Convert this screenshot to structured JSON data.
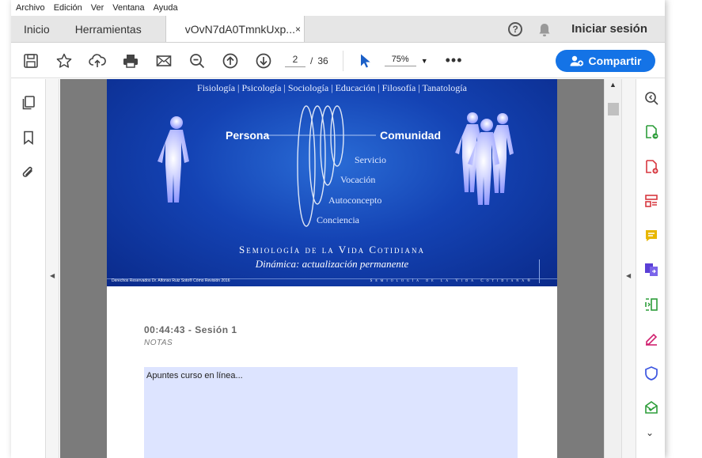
{
  "menubar": {
    "items": [
      "Archivo",
      "Edición",
      "Ver",
      "Ventana",
      "Ayuda"
    ]
  },
  "tabs": {
    "home": "Inicio",
    "tools": "Herramientas",
    "document": "vOvN7dA0TmnkUxp...",
    "close_glyph": "×"
  },
  "header": {
    "help_glyph": "?",
    "signin": "Iniciar sesión"
  },
  "toolbar": {
    "page_current": "2",
    "page_separator": "/",
    "page_total": "36",
    "zoom": "75%",
    "more_glyph": "•••",
    "share_label": "Compartir"
  },
  "icons": {
    "toolbar": [
      "save-icon",
      "bookmark-star-icon",
      "upload-cloud-icon",
      "print-icon",
      "email-icon",
      "zoom-out-icon",
      "page-up-icon",
      "page-down-icon",
      "select-cursor-icon"
    ],
    "left_rail": [
      "pages-panel-icon",
      "bookmarks-icon",
      "attachments-icon"
    ],
    "right_rail": [
      "zoom-tool-icon",
      "export-pdf-icon",
      "create-pdf-icon",
      "organize-pages-icon",
      "comment-icon",
      "combine-files-icon",
      "compress-pdf-icon",
      "fill-sign-icon",
      "protect-icon",
      "send-for-signature-icon"
    ]
  },
  "colors": {
    "accent": "#1473e6",
    "banner": "#1443b4",
    "note_box": "#dde4ff"
  },
  "banner": {
    "topics": "Fisiología | Psicología | Sociología | Educación | Filosofía | Tanatología",
    "persona": "Persona",
    "comunidad": "Comunidad",
    "servicio": "Servicio",
    "vocacion": "Vocación",
    "autoconcepto": "Autoconcepto",
    "conciencia": "Conciencia",
    "title": "Semiología de la Vida Cotidiana",
    "subtitle": "Dinámica: actualización permanente",
    "rights": "Derechos Reservados Dr. Alfonso Ruiz Soto® Cómo Revisión 2016",
    "footer_brand": "Semiología de la Vida Cotidiana®"
  },
  "document": {
    "session": "00:44:43 - Sesión 1",
    "notes_label": "NOTAS",
    "notes_text": "Apuntes curso en línea..."
  }
}
